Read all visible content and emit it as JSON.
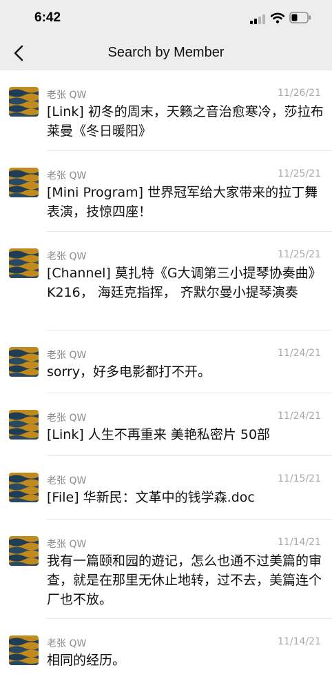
{
  "status_bar": {
    "time": "6:42"
  },
  "nav": {
    "title": "Search by Member"
  },
  "messages": [
    {
      "sender": "老张 QW",
      "date": "11/26/21",
      "text": "[Link] 初冬的周末，天籁之音治愈寒冷，莎拉布莱曼《冬日暖阳》"
    },
    {
      "sender": "老张 QW",
      "date": "11/25/21",
      "text": "[Mini Program]  世界冠军给大家带来的拉丁舞表演，技惊四座！"
    },
    {
      "sender": "老张 QW",
      "date": "11/25/21",
      "text": "[Channel] 莫扎特《G大调第三小提琴协奏曲》 K216， 海廷克指挥， 齐默尔曼小提琴演奏"
    },
    {
      "sender": "老张 QW",
      "date": "11/24/21",
      "text": "sorry，好多电影都打不开。"
    },
    {
      "sender": "老张 QW",
      "date": "11/24/21",
      "text": "[Link] 人生不再重来 美艳私密片 50部"
    },
    {
      "sender": "老张 QW",
      "date": "11/15/21",
      "text": "[File] 华新民：文革中的钱学森.doc"
    },
    {
      "sender": "老张 QW",
      "date": "11/14/21",
      "text": "我有一篇颐和园的遊记，怎么也通不过美篇的审查，就是在那里无休止地转，过不去，美篇连个厂也不放。"
    },
    {
      "sender": "老张 QW",
      "date": "11/14/21",
      "text": "相同的经历。"
    }
  ],
  "colors": {
    "header_bg": "#ededed",
    "meta_text": "#8a8a8a",
    "divider": "#e6e6e6"
  }
}
